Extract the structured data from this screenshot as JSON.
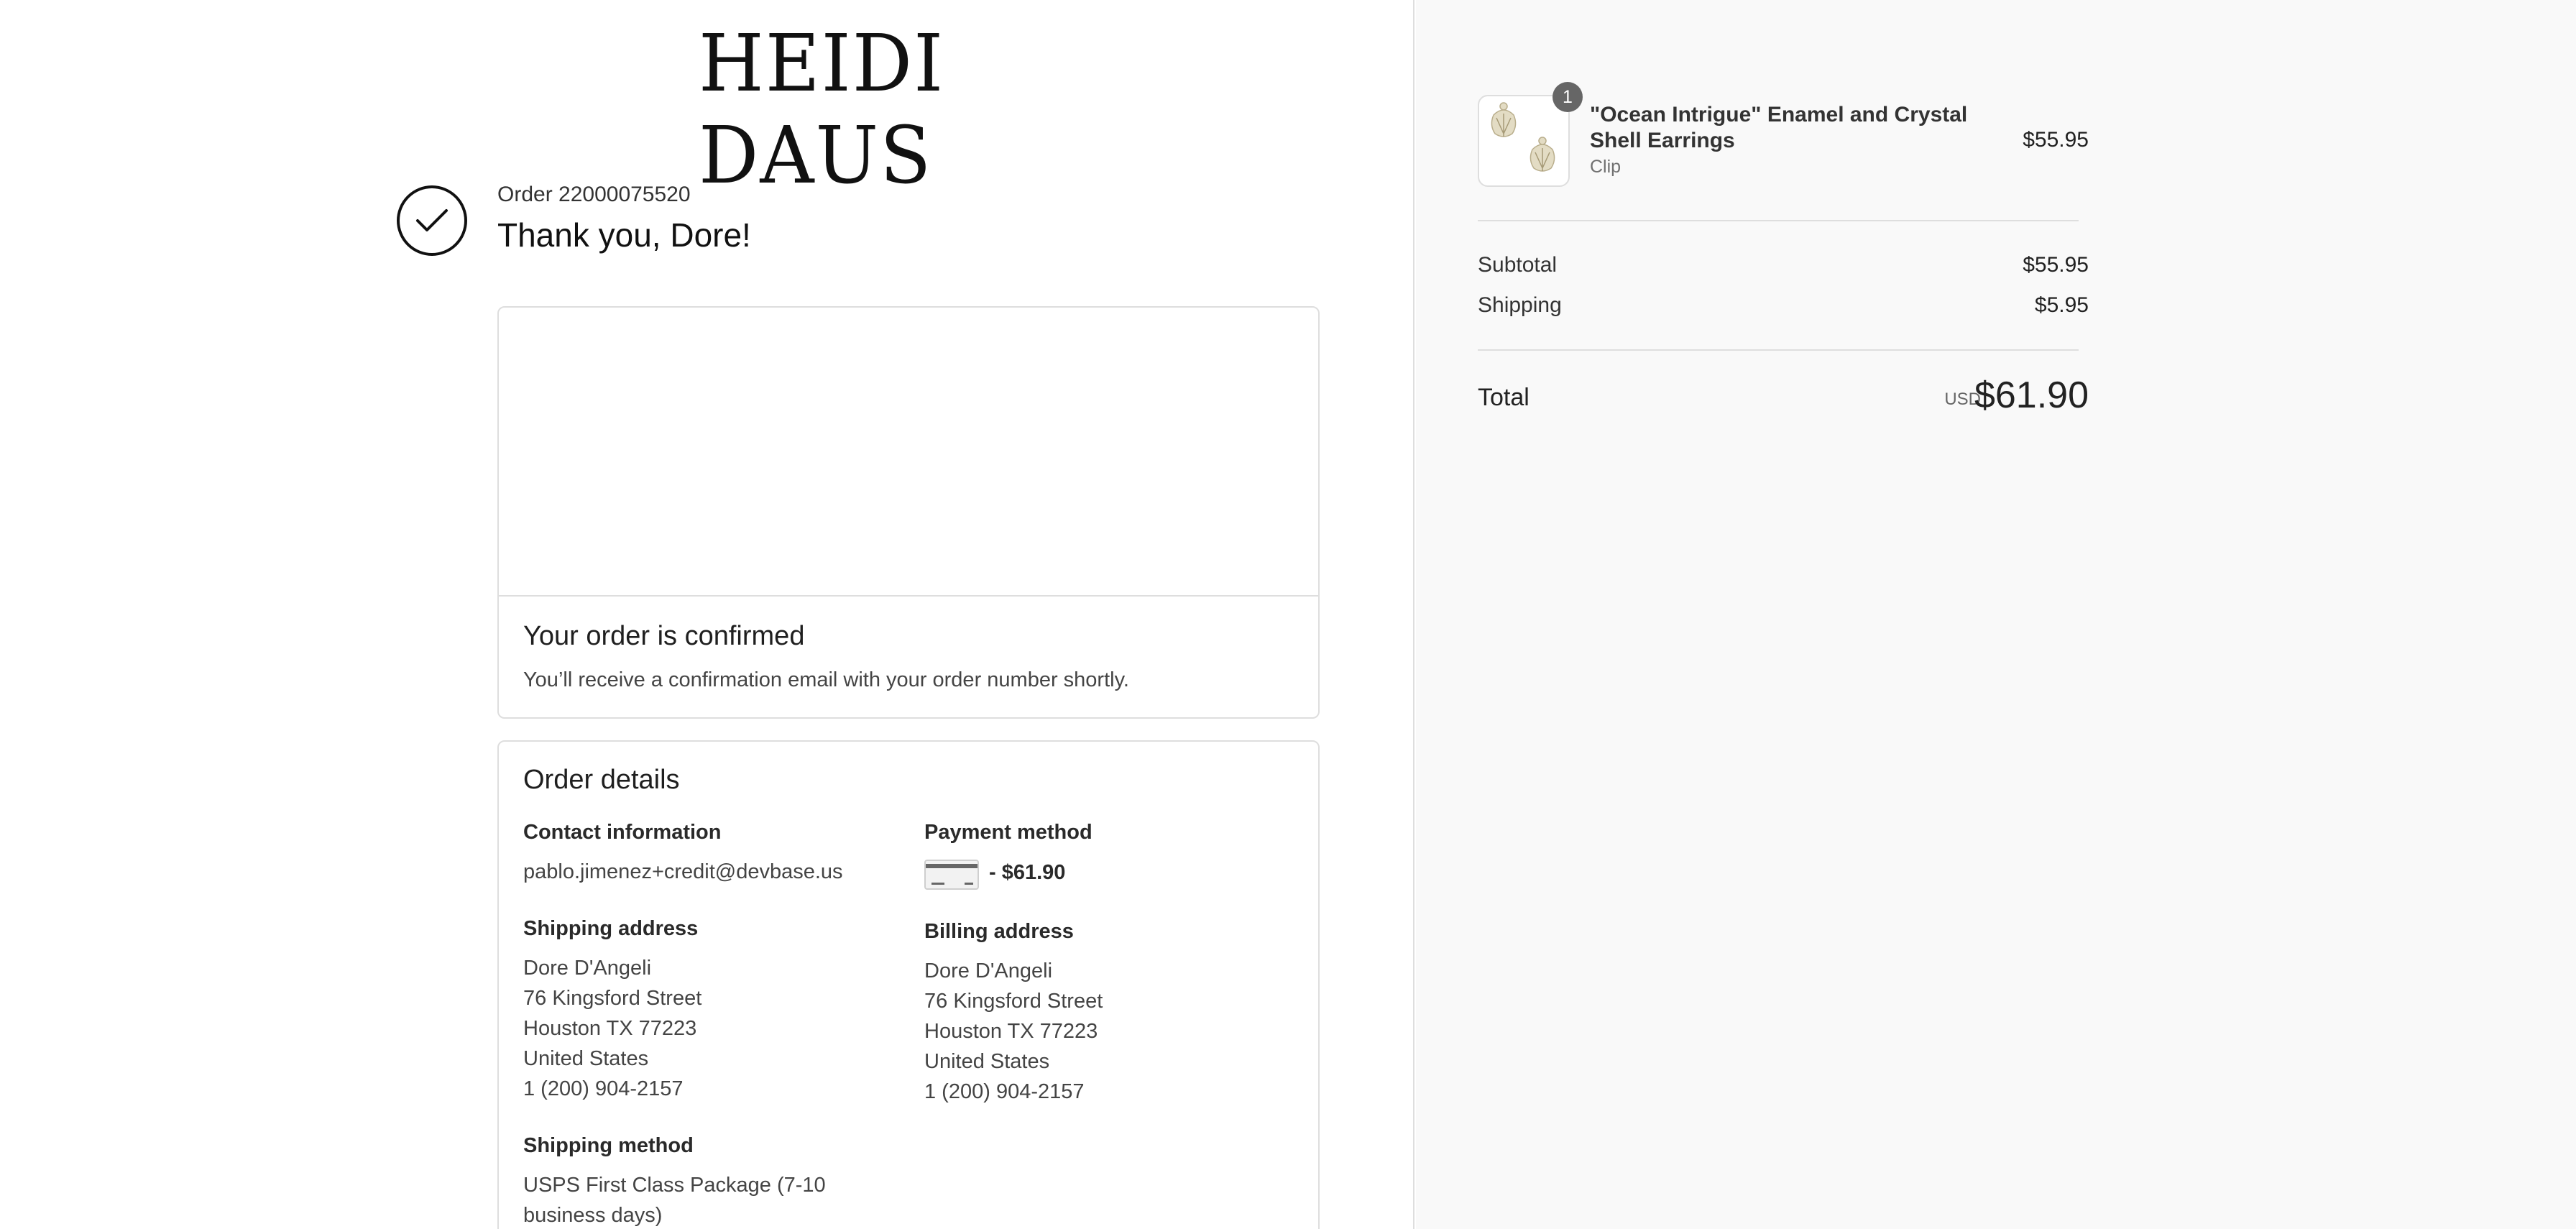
{
  "brand": {
    "logo_text": "HEIDI DAUS"
  },
  "order": {
    "number_label": "Order 22000075520",
    "thank_you": "Thank you, Dore!"
  },
  "confirmation": {
    "title": "Your order is confirmed",
    "text": "You’ll receive a confirmation email with your order number shortly."
  },
  "details": {
    "title": "Order details",
    "contact": {
      "label": "Contact information",
      "email": "pablo.jimenez+credit@devbase.us"
    },
    "payment": {
      "label": "Payment method",
      "amount": "- $61.90",
      "icon": "credit-card-icon"
    },
    "shipping_address": {
      "label": "Shipping address",
      "lines": [
        "Dore D'Angeli",
        "76 Kingsford Street",
        "Houston TX 77223",
        "United States",
        "1 (200) 904-2157"
      ]
    },
    "billing_address": {
      "label": "Billing address",
      "lines": [
        "Dore D'Angeli",
        "76 Kingsford Street",
        "Houston TX 77223",
        "United States",
        "1 (200) 904-2157"
      ]
    },
    "shipping_method": {
      "label": "Shipping method",
      "lines": [
        "USPS First Class Package (7-10",
        "business days)"
      ]
    }
  },
  "summary": {
    "item": {
      "quantity": "1",
      "name_lines": [
        "\"Ocean Intrigue\" Enamel and Crystal",
        "Shell Earrings"
      ],
      "variant": "Clip",
      "price": "$55.95"
    },
    "subtotal_label": "Subtotal",
    "subtotal_value": "$55.95",
    "shipping_label": "Shipping",
    "shipping_value": "$5.95",
    "total_label": "Total",
    "currency": "USD",
    "total_value": "$61.90"
  },
  "colors": {
    "panel_bg": "#f9f9f9",
    "border": "#dedede",
    "badge": "#666666"
  }
}
